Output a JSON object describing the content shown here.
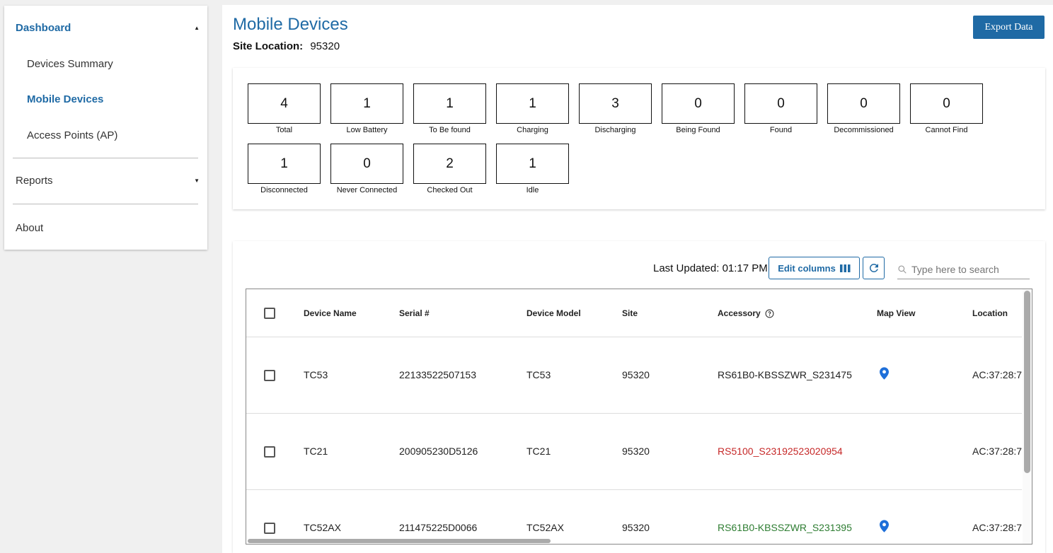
{
  "sidebar": {
    "dashboard": "Dashboard",
    "sub_items": [
      "Devices Summary",
      "Mobile Devices",
      "Access Points (AP)"
    ],
    "reports": "Reports",
    "about": "About"
  },
  "header": {
    "title": "Mobile Devices",
    "site_label": "Site Location:",
    "site_value": "95320",
    "export_label": "Export Data"
  },
  "stats": [
    {
      "value": "4",
      "label": "Total"
    },
    {
      "value": "1",
      "label": "Low Battery"
    },
    {
      "value": "1",
      "label": "To Be found"
    },
    {
      "value": "1",
      "label": "Charging"
    },
    {
      "value": "3",
      "label": "Discharging"
    },
    {
      "value": "0",
      "label": "Being Found"
    },
    {
      "value": "0",
      "label": "Found"
    },
    {
      "value": "0",
      "label": "Decommissioned"
    },
    {
      "value": "0",
      "label": "Cannot Find"
    },
    {
      "value": "1",
      "label": "Disconnected"
    },
    {
      "value": "0",
      "label": "Never Connected"
    },
    {
      "value": "2",
      "label": "Checked Out"
    },
    {
      "value": "1",
      "label": "Idle"
    }
  ],
  "toolbar": {
    "last_updated": "Last Updated: 01:17 PM",
    "edit_columns": "Edit columns",
    "search_placeholder": "Type here to search"
  },
  "table": {
    "columns": [
      "Device Name",
      "Serial #",
      "Device Model",
      "Site",
      "Accessory",
      "Map View",
      "Location"
    ],
    "rows": [
      {
        "name": "TC53",
        "serial": "22133522507153",
        "model": "TC53",
        "site": "95320",
        "accessory": "RS61B0-KBSSZWR_S231475",
        "accessory_color": "#222222",
        "map": true,
        "location": "AC:37:28:7"
      },
      {
        "name": "TC21",
        "serial": "200905230D5126",
        "model": "TC21",
        "site": "95320",
        "accessory": "RS5100_S23192523020954",
        "accessory_color": "#c62828",
        "map": false,
        "location": "AC:37:28:7"
      },
      {
        "name": "TC52AX",
        "serial": "211475225D0066",
        "model": "TC52AX",
        "site": "95320",
        "accessory": "RS61B0-KBSSZWR_S231395",
        "accessory_color": "#2e7d32",
        "map": true,
        "location": "AC:37:28:7"
      }
    ]
  },
  "colors": {
    "primary": "#1f6aa5",
    "map_pin": "#1e6fd9"
  }
}
